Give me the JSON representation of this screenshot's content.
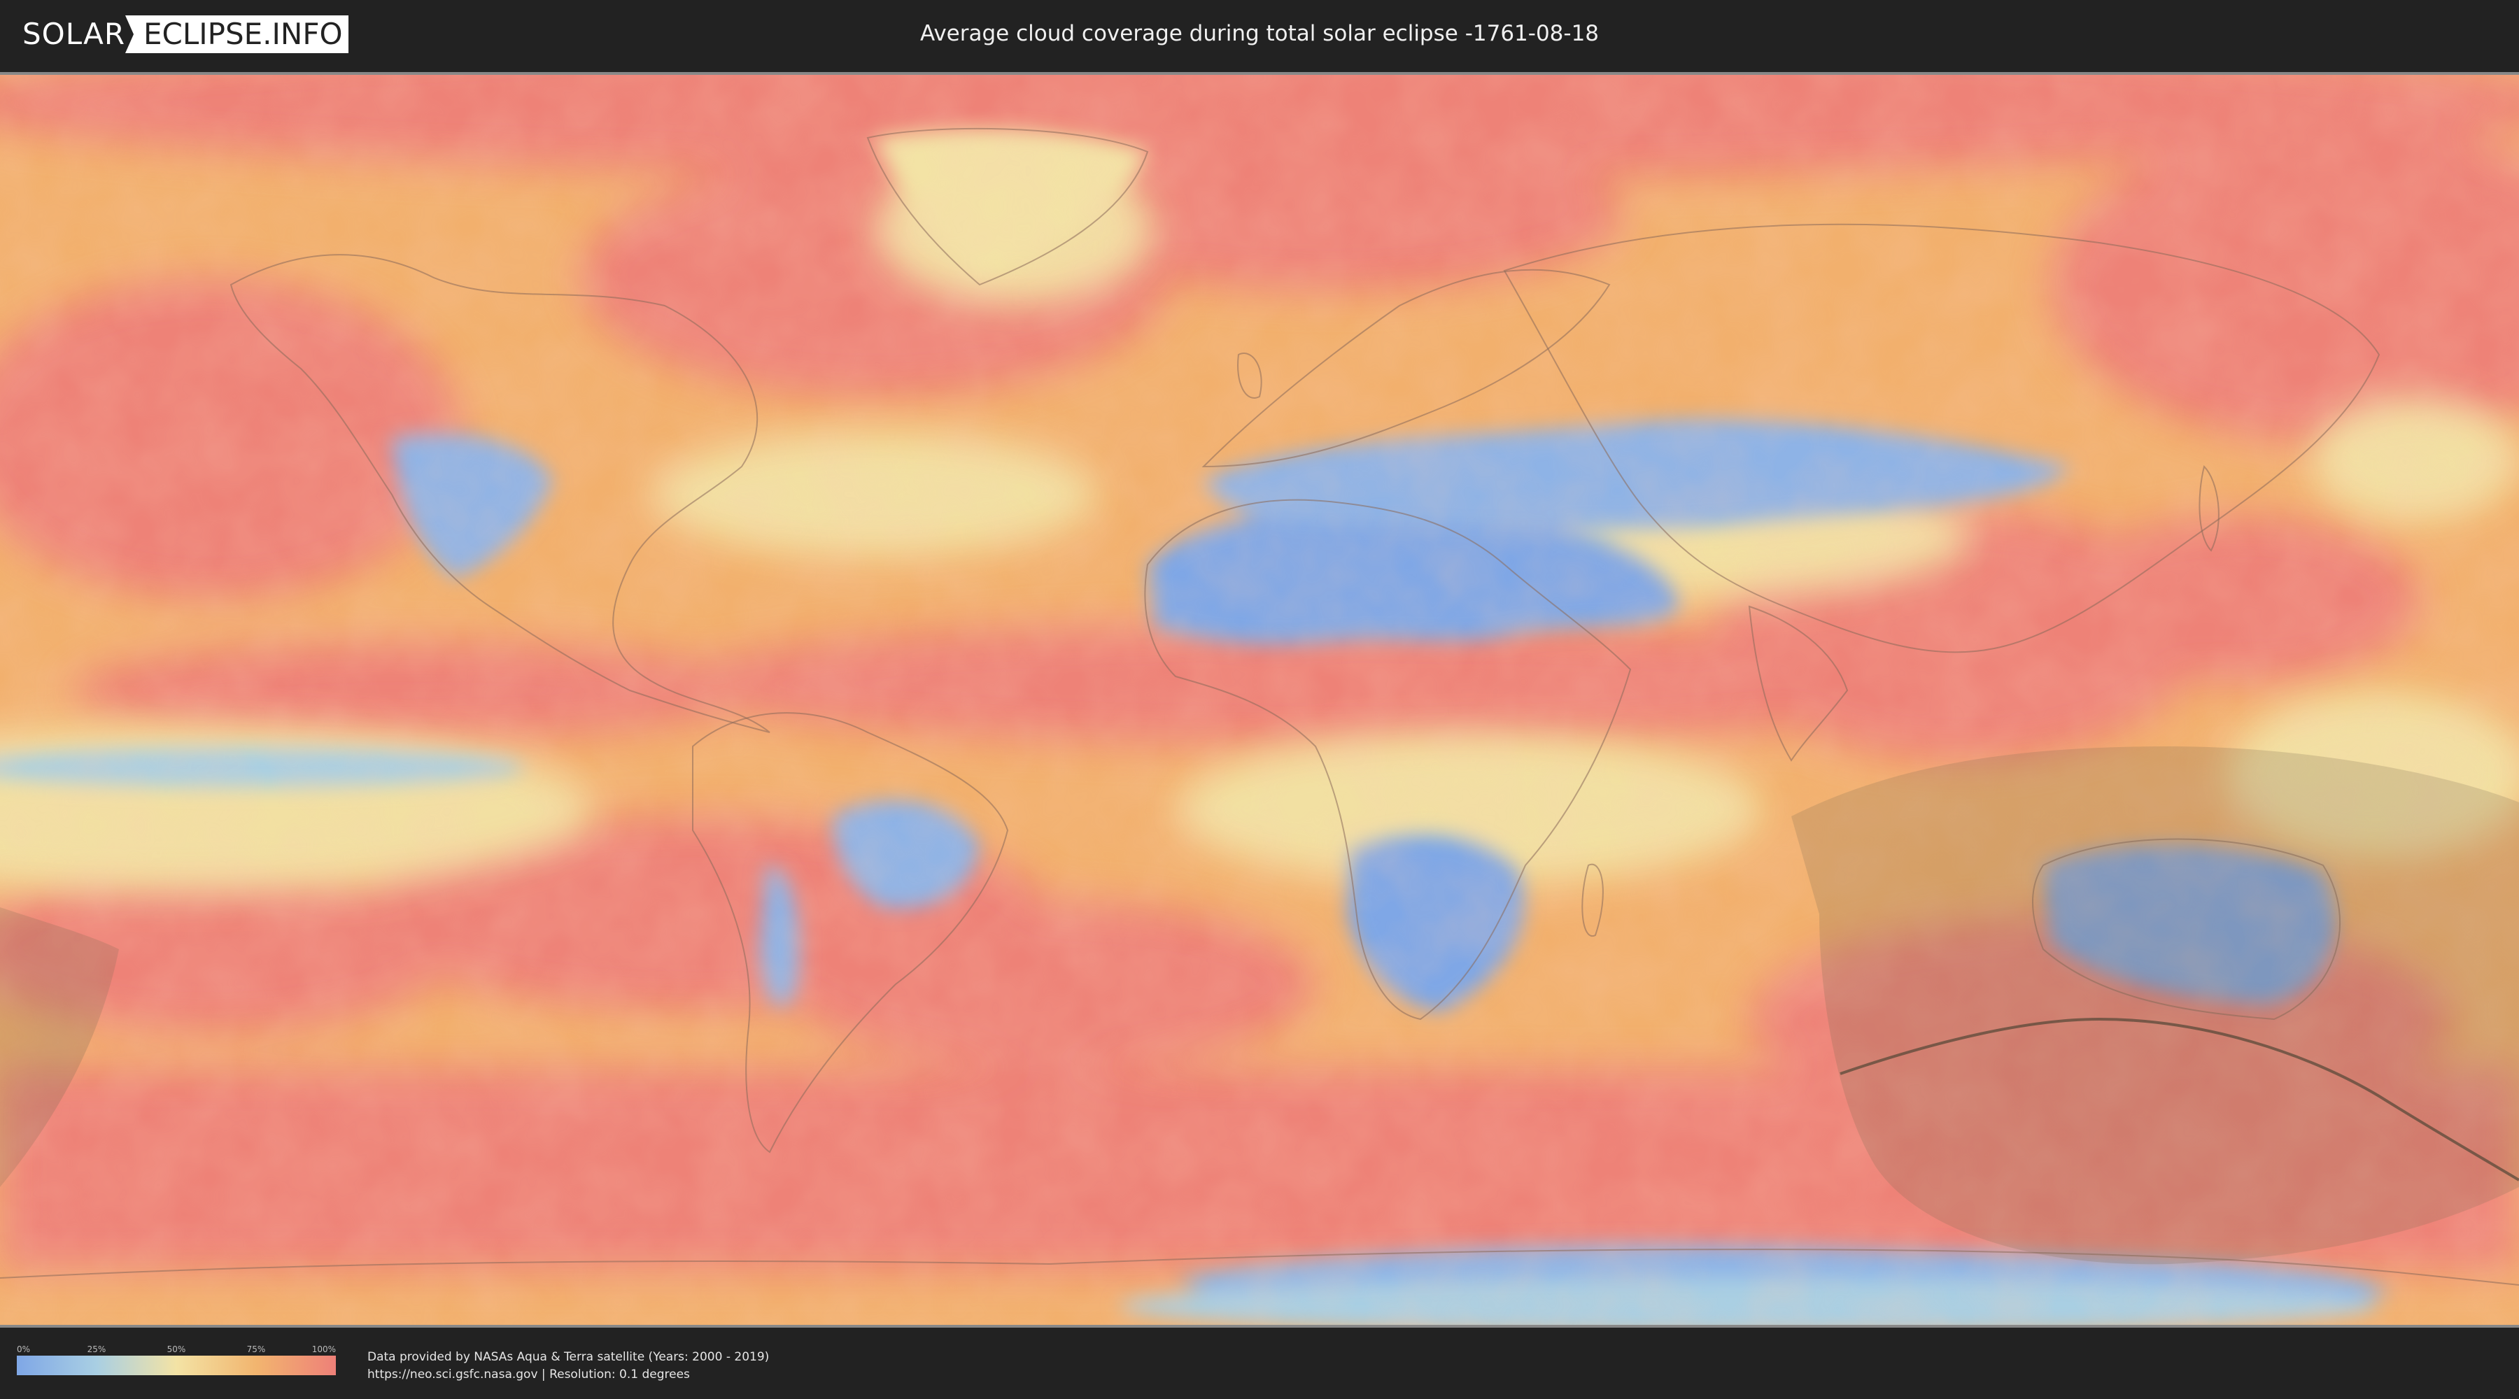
{
  "header": {
    "logo_left": "SOLAR",
    "logo_right": "ECLIPSE.INFO",
    "title": "Average cloud coverage during total solar eclipse -1761-08-18"
  },
  "legend": {
    "ticks": [
      "0%",
      "25%",
      "50%",
      "75%",
      "100%"
    ],
    "colors": [
      "#7fa7e6",
      "#a9cfe3",
      "#f3e3a5",
      "#f2b56f",
      "#ee8078"
    ]
  },
  "footer": {
    "source_line": "Data provided by NASAs Aqua & Terra satellite (Years: 2000 - 2019)",
    "url": "https://neo.sci.gsfc.nasa.gov",
    "separator": " | ",
    "resolution": "Resolution: 0.1 degrees"
  },
  "map": {
    "projection": "equirectangular",
    "colors": {
      "clear": "#7fa7e6",
      "light": "#a9cfe3",
      "mid": "#f3e3a5",
      "orange": "#f2b06d",
      "cloudy": "#ee8078",
      "eclipse_shade": "#7a6a50",
      "eclipse_line": "#5a4a3a",
      "borders": "#8a6a5a"
    }
  }
}
